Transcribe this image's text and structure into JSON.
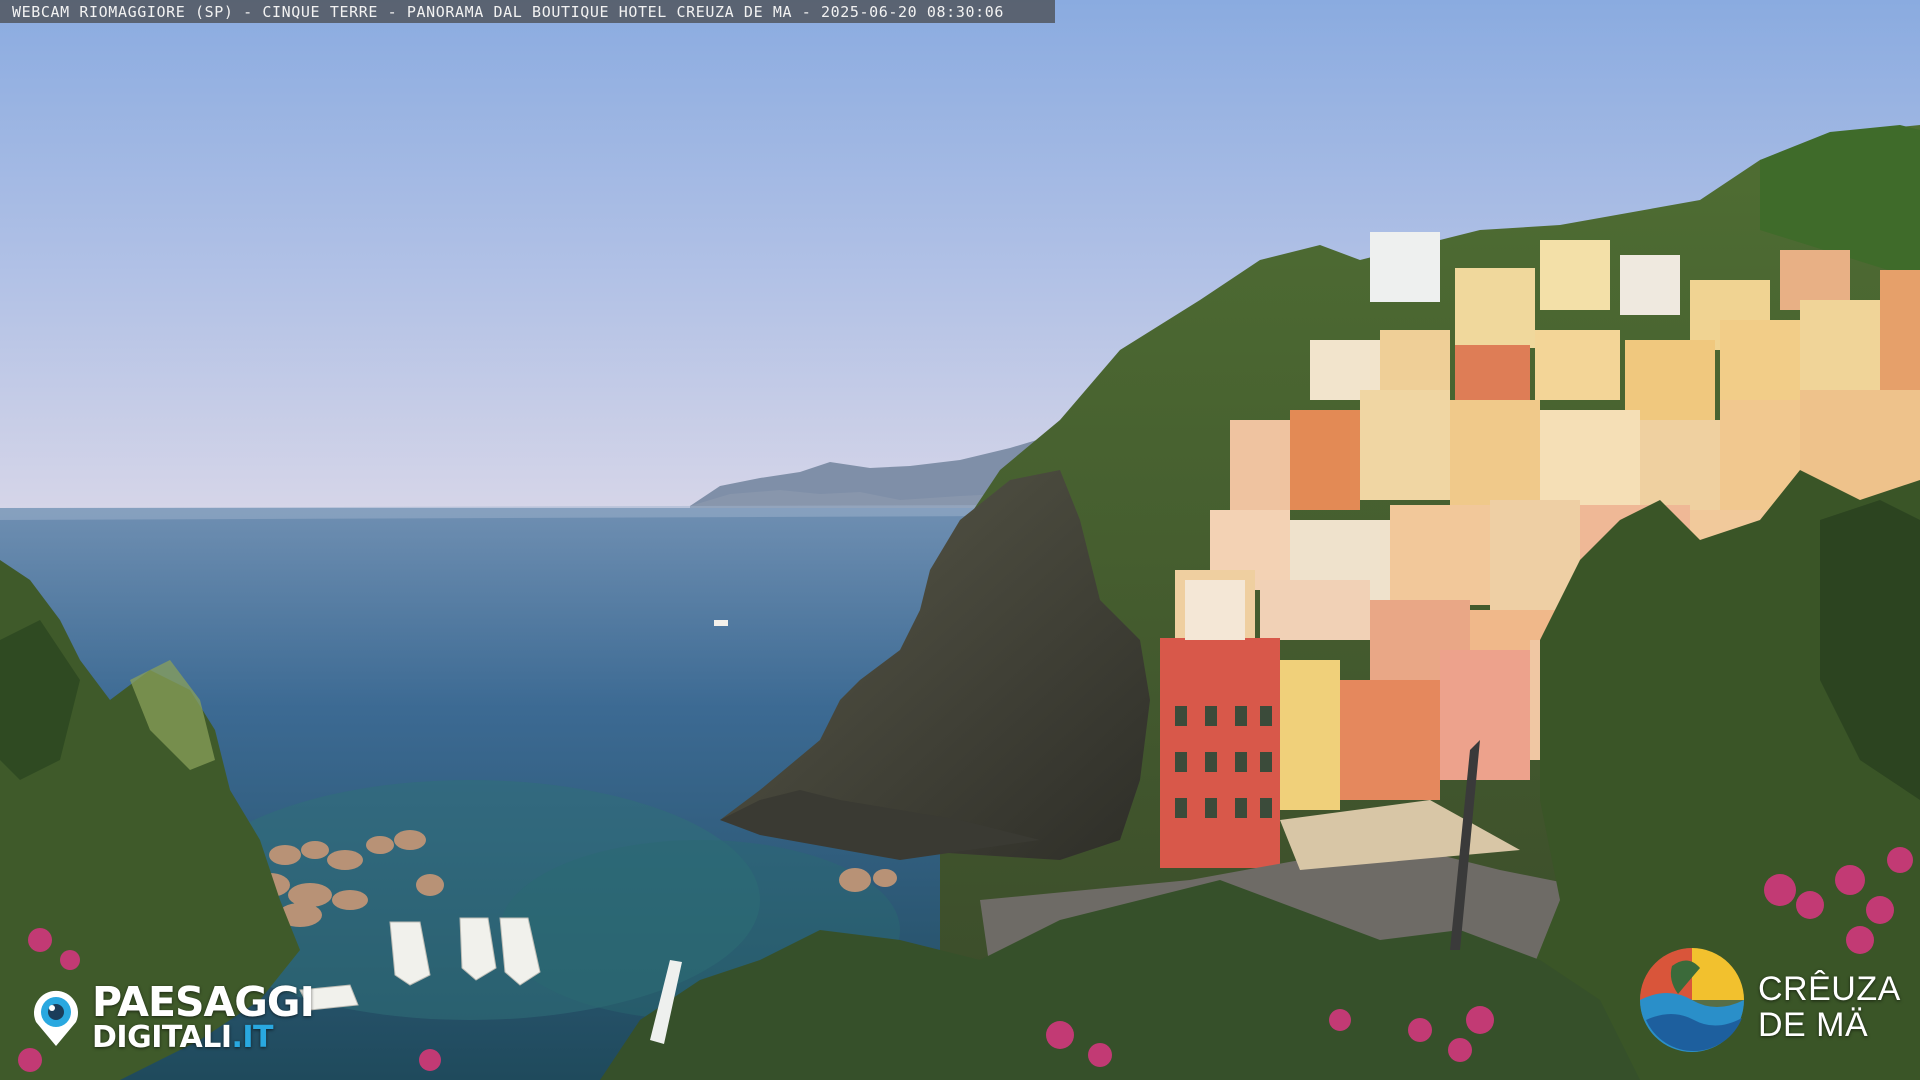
{
  "caption": {
    "text": "WEBCAM RIOMAGGIORE (SP) - CINQUE TERRE - PANORAMA DAL BOUTIQUE HOTEL CREUZA DE MA - 2025-06-20 08:30:06"
  },
  "logo_left": {
    "line1": "PAESAGGI",
    "line2": "DIGITALI",
    "line2_suffix": ".IT"
  },
  "logo_right": {
    "line1": "CRÊUZA",
    "line2": "DE MÄ"
  },
  "colors": {
    "sky_top": "#8fb0e2",
    "sea": "#2f5a7e",
    "building_red": "#d8584a",
    "foliage": "#3d5a2a",
    "bougainvillea": "#c23a74",
    "logo_accent": "#29a8e0"
  }
}
